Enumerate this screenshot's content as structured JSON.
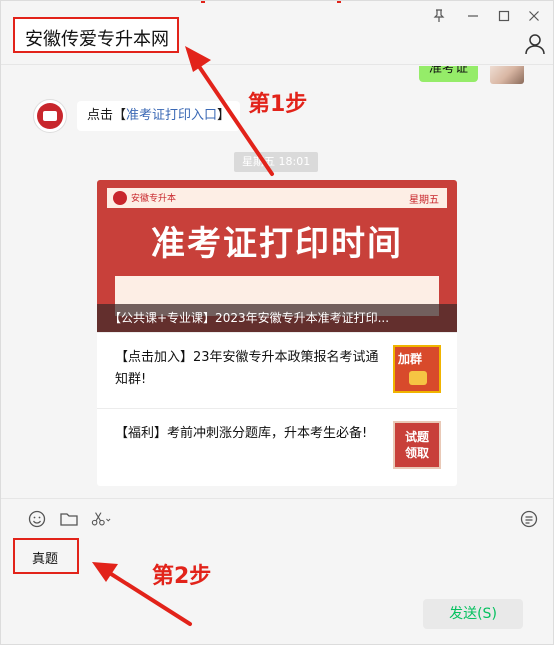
{
  "window": {
    "title": "安徽传爱专升本网"
  },
  "chat": {
    "my_message": "准考证",
    "their_message_prefix": "点击【",
    "their_message_link": "准考证打印入口",
    "their_message_suffix": "】",
    "timestamp": "星期五  18:01"
  },
  "article": {
    "cover_brand": "安徽专升本",
    "cover_day": "星期五",
    "cover_title": "准考证打印时间",
    "cover_caption": "【公共课+专业课】2023年安徽专升本准考证打印...",
    "items": [
      {
        "text": "【点击加入】23年安徽专升本政策报名考试通知群!",
        "thumb_label": "加群"
      },
      {
        "text": "【福利】考前冲刺涨分题库，升本考生必备!",
        "thumb_label": "试题\n领取"
      }
    ]
  },
  "annotations": {
    "step1": "第1步",
    "step2": "第2步"
  },
  "composer": {
    "input_value": "真题",
    "send_label": "发送(S)"
  },
  "colors": {
    "annotation_red": "#e2231a",
    "my_bubble": "#95ec69",
    "send_text": "#07c160",
    "cover_red": "#c8403a"
  }
}
